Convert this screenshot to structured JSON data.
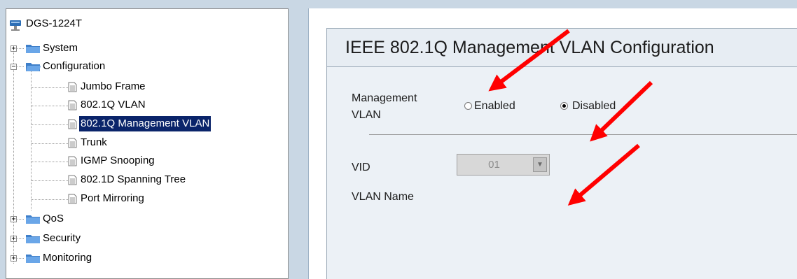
{
  "tree": {
    "root": "DGS-1224T",
    "items": [
      {
        "label": "System",
        "type": "folder",
        "expander": "+"
      },
      {
        "label": "Configuration",
        "type": "folder",
        "expander": "−"
      },
      {
        "label": "Jumbo Frame",
        "type": "doc"
      },
      {
        "label": "802.1Q VLAN",
        "type": "doc"
      },
      {
        "label": "802.1Q Management VLAN",
        "type": "doc",
        "selected": true
      },
      {
        "label": "Trunk",
        "type": "doc"
      },
      {
        "label": "IGMP Snooping",
        "type": "doc"
      },
      {
        "label": "802.1D Spanning Tree",
        "type": "doc"
      },
      {
        "label": "Port Mirroring",
        "type": "doc"
      },
      {
        "label": "QoS",
        "type": "folder",
        "expander": "+"
      },
      {
        "label": "Security",
        "type": "folder",
        "expander": "+"
      },
      {
        "label": "Monitoring",
        "type": "folder",
        "expander": "+"
      }
    ]
  },
  "config": {
    "title": "IEEE 802.1Q Management VLAN Configuration",
    "management_label_line1": "Management",
    "management_label_line2": "VLAN",
    "enabled_label": "Enabled",
    "disabled_label": "Disabled",
    "selected_option": "Disabled",
    "vid_label": "VID",
    "vid_value": "01",
    "vlan_name_label": "VLAN Name"
  },
  "colors": {
    "arrow": "#ff0000",
    "selection": "#0a246a",
    "folder": "#4d86c7"
  }
}
